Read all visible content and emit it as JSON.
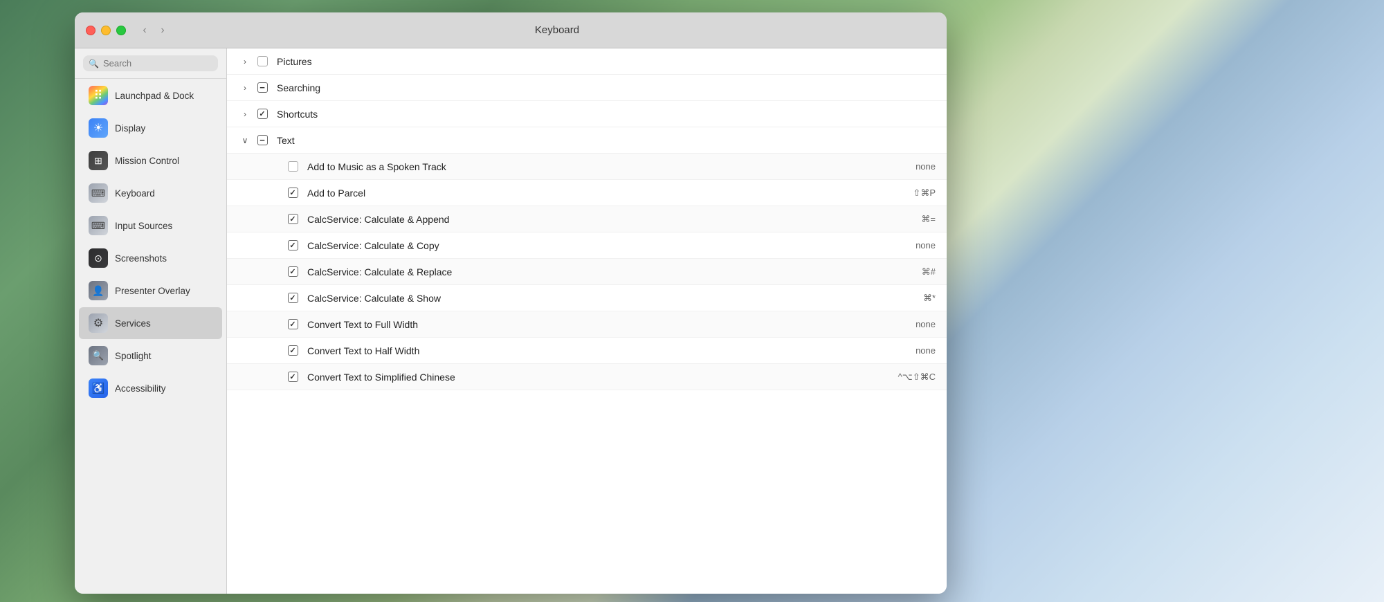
{
  "window": {
    "title": "Keyboard",
    "nav_back": "‹",
    "nav_forward": "›"
  },
  "sidebar": {
    "search_placeholder": "Search",
    "items": [
      {
        "id": "launchpad",
        "label": "Launchpad & Dock",
        "icon": "launchpad",
        "active": false
      },
      {
        "id": "display",
        "label": "Display",
        "icon": "display",
        "active": false
      },
      {
        "id": "mission-control",
        "label": "Mission Control",
        "icon": "mission",
        "active": false
      },
      {
        "id": "keyboard",
        "label": "Keyboard",
        "icon": "keyboard",
        "active": false
      },
      {
        "id": "input-sources",
        "label": "Input Sources",
        "icon": "input",
        "active": false
      },
      {
        "id": "screenshots",
        "label": "Screenshots",
        "icon": "screenshots",
        "active": false
      },
      {
        "id": "presenter-overlay",
        "label": "Presenter Overlay",
        "icon": "presenter",
        "active": false
      },
      {
        "id": "services",
        "label": "Services",
        "icon": "services",
        "active": true
      },
      {
        "id": "spotlight",
        "label": "Spotlight",
        "icon": "spotlight",
        "active": false
      },
      {
        "id": "accessibility",
        "label": "Accessibility",
        "icon": "accessibility",
        "active": false
      }
    ]
  },
  "main": {
    "tree_rows": [
      {
        "id": "pictures",
        "level": 0,
        "chevron": "›",
        "checkbox": "unchecked",
        "label": "Pictures",
        "shortcut": ""
      },
      {
        "id": "searching",
        "level": 0,
        "chevron": "›",
        "checkbox": "indeterminate",
        "label": "Searching",
        "shortcut": ""
      },
      {
        "id": "shortcuts",
        "level": 0,
        "chevron": "›",
        "checkbox": "checked",
        "label": "Shortcuts",
        "shortcut": ""
      },
      {
        "id": "text",
        "level": 0,
        "chevron": "∨",
        "checkbox": "indeterminate",
        "label": "Text",
        "shortcut": ""
      },
      {
        "id": "add-to-music",
        "level": 1,
        "chevron": "",
        "checkbox": "unchecked",
        "label": "Add to Music as a Spoken Track",
        "shortcut": "none"
      },
      {
        "id": "add-to-parcel",
        "level": 1,
        "chevron": "",
        "checkbox": "checked",
        "label": "Add to Parcel",
        "shortcut": "⇧⌘P"
      },
      {
        "id": "calc-append",
        "level": 1,
        "chevron": "",
        "checkbox": "checked",
        "label": "CalcService: Calculate & Append",
        "shortcut": "⌘="
      },
      {
        "id": "calc-copy",
        "level": 1,
        "chevron": "",
        "checkbox": "checked",
        "label": "CalcService: Calculate & Copy",
        "shortcut": "none"
      },
      {
        "id": "calc-replace",
        "level": 1,
        "chevron": "",
        "checkbox": "checked",
        "label": "CalcService: Calculate & Replace",
        "shortcut": "⌘#"
      },
      {
        "id": "calc-show",
        "level": 1,
        "chevron": "",
        "checkbox": "checked",
        "label": "CalcService: Calculate & Show",
        "shortcut": "⌘*"
      },
      {
        "id": "convert-full",
        "level": 1,
        "chevron": "",
        "checkbox": "checked",
        "label": "Convert Text to Full Width",
        "shortcut": "none"
      },
      {
        "id": "convert-half",
        "level": 1,
        "chevron": "",
        "checkbox": "checked",
        "label": "Convert Text to Half Width",
        "shortcut": "none"
      },
      {
        "id": "convert-simplified",
        "level": 1,
        "chevron": "",
        "checkbox": "checked",
        "label": "Convert Text to Simplified Chinese",
        "shortcut": "^⌥⇧⌘C"
      }
    ]
  }
}
